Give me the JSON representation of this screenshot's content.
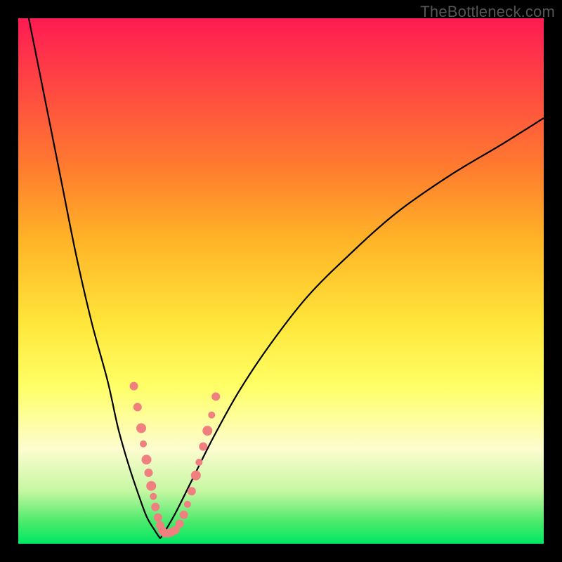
{
  "watermark": "TheBottleneck.com",
  "colors": {
    "background": "#000000",
    "watermark_text": "#555555",
    "curve_stroke": "#000000",
    "marker_fill": "#f08080",
    "gradient_top": "#ff1b53",
    "gradient_bottom": "#00e864"
  },
  "chart_data": {
    "type": "line",
    "title": "",
    "xlabel": "",
    "ylabel": "",
    "xlim": [
      0,
      100
    ],
    "ylim": [
      0,
      100
    ],
    "grid": false,
    "series": [
      {
        "name": "left-curve",
        "x": [
          2,
          5,
          8,
          11,
          14,
          17,
          19,
          21,
          23,
          24.5,
          26,
          27
        ],
        "y": [
          100,
          85,
          70,
          55,
          42,
          31,
          22,
          15,
          9,
          5,
          2.5,
          1
        ]
      },
      {
        "name": "right-curve",
        "x": [
          27,
          28,
          30,
          33,
          37,
          42,
          48,
          55,
          63,
          72,
          82,
          92,
          100
        ],
        "y": [
          1,
          2.5,
          6,
          12,
          20,
          29,
          38,
          47,
          55,
          63,
          70,
          76,
          81
        ]
      }
    ],
    "markers": [
      {
        "x": 22.0,
        "y": 30,
        "r": 6
      },
      {
        "x": 22.7,
        "y": 26,
        "r": 6
      },
      {
        "x": 23.4,
        "y": 22,
        "r": 7
      },
      {
        "x": 23.8,
        "y": 19,
        "r": 5
      },
      {
        "x": 24.4,
        "y": 16,
        "r": 7
      },
      {
        "x": 24.8,
        "y": 13.5,
        "r": 6
      },
      {
        "x": 25.3,
        "y": 11,
        "r": 7
      },
      {
        "x": 25.7,
        "y": 9,
        "r": 5
      },
      {
        "x": 26.1,
        "y": 7,
        "r": 6
      },
      {
        "x": 26.6,
        "y": 5,
        "r": 6
      },
      {
        "x": 27.0,
        "y": 3.5,
        "r": 6
      },
      {
        "x": 27.4,
        "y": 2.5,
        "r": 6
      },
      {
        "x": 27.9,
        "y": 2.0,
        "r": 6
      },
      {
        "x": 28.5,
        "y": 2.0,
        "r": 6
      },
      {
        "x": 29.2,
        "y": 2.2,
        "r": 6
      },
      {
        "x": 29.9,
        "y": 2.6,
        "r": 6
      },
      {
        "x": 30.7,
        "y": 3.8,
        "r": 6
      },
      {
        "x": 31.5,
        "y": 5.5,
        "r": 6
      },
      {
        "x": 32.2,
        "y": 7.5,
        "r": 5
      },
      {
        "x": 33.0,
        "y": 10,
        "r": 6
      },
      {
        "x": 33.8,
        "y": 13,
        "r": 7
      },
      {
        "x": 34.4,
        "y": 15.5,
        "r": 5
      },
      {
        "x": 35.2,
        "y": 18.5,
        "r": 6
      },
      {
        "x": 36.0,
        "y": 21.5,
        "r": 7
      },
      {
        "x": 36.8,
        "y": 24.5,
        "r": 5
      },
      {
        "x": 37.6,
        "y": 28,
        "r": 6
      }
    ]
  }
}
